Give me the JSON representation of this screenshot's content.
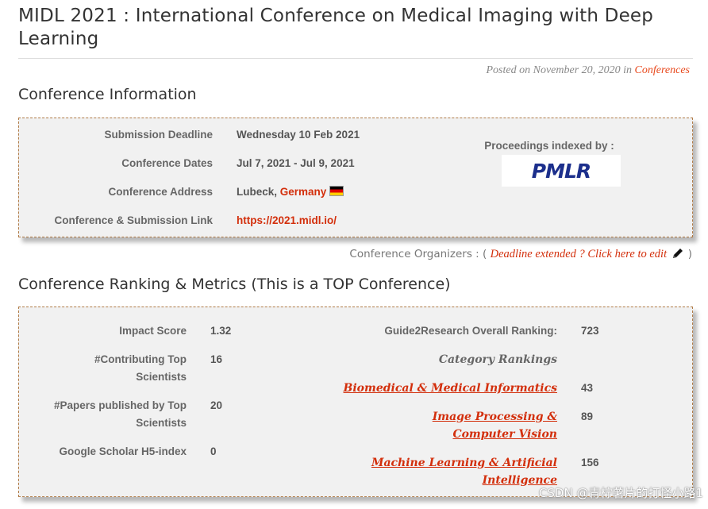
{
  "page": {
    "title": "MIDL 2021 : International Conference on Medical Imaging with Deep Learning",
    "posted_prefix": "Posted on November 20, 2020 in",
    "posted_category": "Conferences"
  },
  "conference_info": {
    "heading": "Conference Information",
    "rows": [
      {
        "label": "Submission Deadline",
        "value": "Wednesday 10 Feb 2021"
      },
      {
        "label": "Conference Dates",
        "value": "Jul 7, 2021 - Jul 9, 2021"
      },
      {
        "label": "Conference Address",
        "value": "Lubeck,",
        "country": "Germany",
        "flag_icon": "germany-flag-icon"
      },
      {
        "label": "Conference & Submission Link",
        "value": "https://2021.midl.io/"
      }
    ],
    "proceedings_label": "Proceedings indexed by :",
    "proceedings_logo_text": "PMLR",
    "accent_color": "#d32f0c"
  },
  "organizers": {
    "prefix": "Conference Organizers : (",
    "link": "Deadline extended ? Click here to edit",
    "suffix": ")",
    "icon": "pencil-icon"
  },
  "ranking": {
    "heading": "Conference Ranking & Metrics (This is a TOP Conference)",
    "metrics": [
      {
        "label": "Impact Score",
        "value": "1.32"
      },
      {
        "label": "#Contributing Top Scientists",
        "value": "16"
      },
      {
        "label": "#Papers published by Top Scientists",
        "value": "20"
      },
      {
        "label": "Google Scholar H5-index",
        "value": "0"
      }
    ],
    "overall_label": "Guide2Research Overall Ranking:",
    "overall_value": "723",
    "category_heading": "Category Rankings",
    "categories": [
      {
        "name": "Biomedical & Medical Informatics",
        "rank": "43"
      },
      {
        "name": "Image Processing & Computer Vision",
        "rank": "89"
      },
      {
        "name": "Machine Learning & Artificial Intelligence",
        "rank": "156"
      }
    ]
  },
  "watermark": "CSDN @青柠薯片的打怪小路1"
}
